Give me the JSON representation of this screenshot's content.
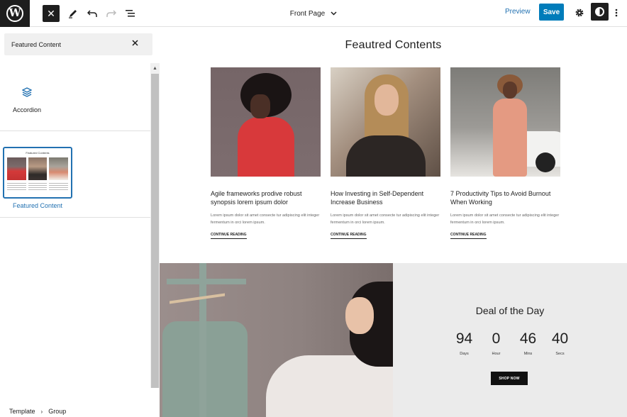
{
  "topbar": {
    "logo": "W",
    "close_icon": "✕",
    "document_title": "Front Page",
    "preview_label": "Preview",
    "save_label": "Save"
  },
  "sidebar": {
    "search_value": "Featured Content",
    "blocks": [
      {
        "label": "Accordion",
        "icon": "layers-icon"
      }
    ],
    "patterns": [
      {
        "label": "Featured Content",
        "thumb_title": "Featured Contents"
      }
    ],
    "breadcrumb": [
      "Template",
      "Group"
    ]
  },
  "canvas": {
    "section_title": "Feautred Contents",
    "posts": [
      {
        "title": "Agile frameworks prodive robust synopsis lorem ipsum dolor",
        "excerpt": "Lorem ipsum dolor sit amet consecte tur adipiscing elit integer fermentum in orci lorem ipsum.",
        "more": "CONTINUE READING"
      },
      {
        "title": "How Investing in Self-Dependent Increase Business",
        "excerpt": "Lorem ipsum dolor sit amet consecte tur adipiscing elit integer fermentum in orci lorem ipsum.",
        "more": "CONTINUE READING"
      },
      {
        "title": "7 Productivity Tips to Avoid Burnout When Working",
        "excerpt": "Lorem ipsum dolor sit amet consecte tur adipiscing elit integer fermentum in orci lorem ipsum.",
        "more": "CONTINUE READING"
      }
    ],
    "deal": {
      "title": "Deal of the Day",
      "countdown": [
        {
          "value": "94",
          "label": "Days"
        },
        {
          "value": "0",
          "label": "Hour"
        },
        {
          "value": "46",
          "label": "Mins"
        },
        {
          "value": "40",
          "label": "Secs"
        }
      ],
      "button": "SHOP NOW"
    }
  },
  "colors": {
    "accent": "#007cba",
    "link": "#2271b1",
    "dark": "#1e1e1e"
  }
}
